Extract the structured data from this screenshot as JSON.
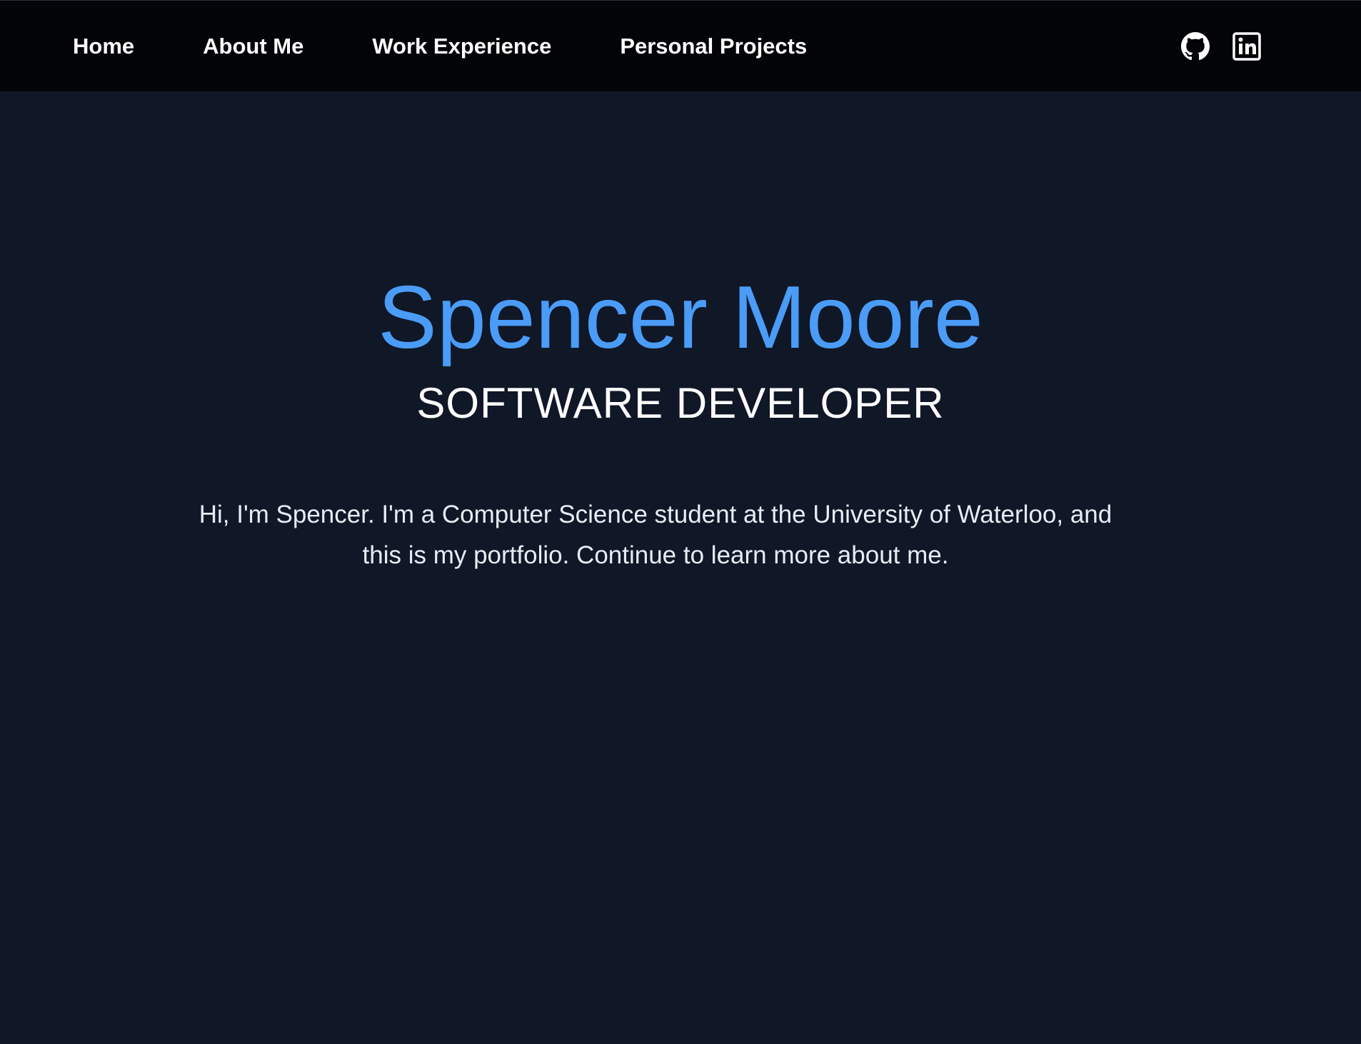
{
  "nav": {
    "links": [
      {
        "label": "Home"
      },
      {
        "label": "About Me"
      },
      {
        "label": "Work Experience"
      },
      {
        "label": "Personal Projects"
      }
    ],
    "icons": [
      "github-icon",
      "linkedin-icon"
    ]
  },
  "hero": {
    "name": "Spencer Moore",
    "title": "SOFTWARE DEVELOPER",
    "intro": "Hi, I'm Spencer. I'm a Computer Science student at the University of Waterloo, and this is my portfolio. Continue to learn more about me."
  },
  "colors": {
    "background": "#101727",
    "navbar": "#030407",
    "accent": "#4a9cf7",
    "text": "#ffffff"
  }
}
